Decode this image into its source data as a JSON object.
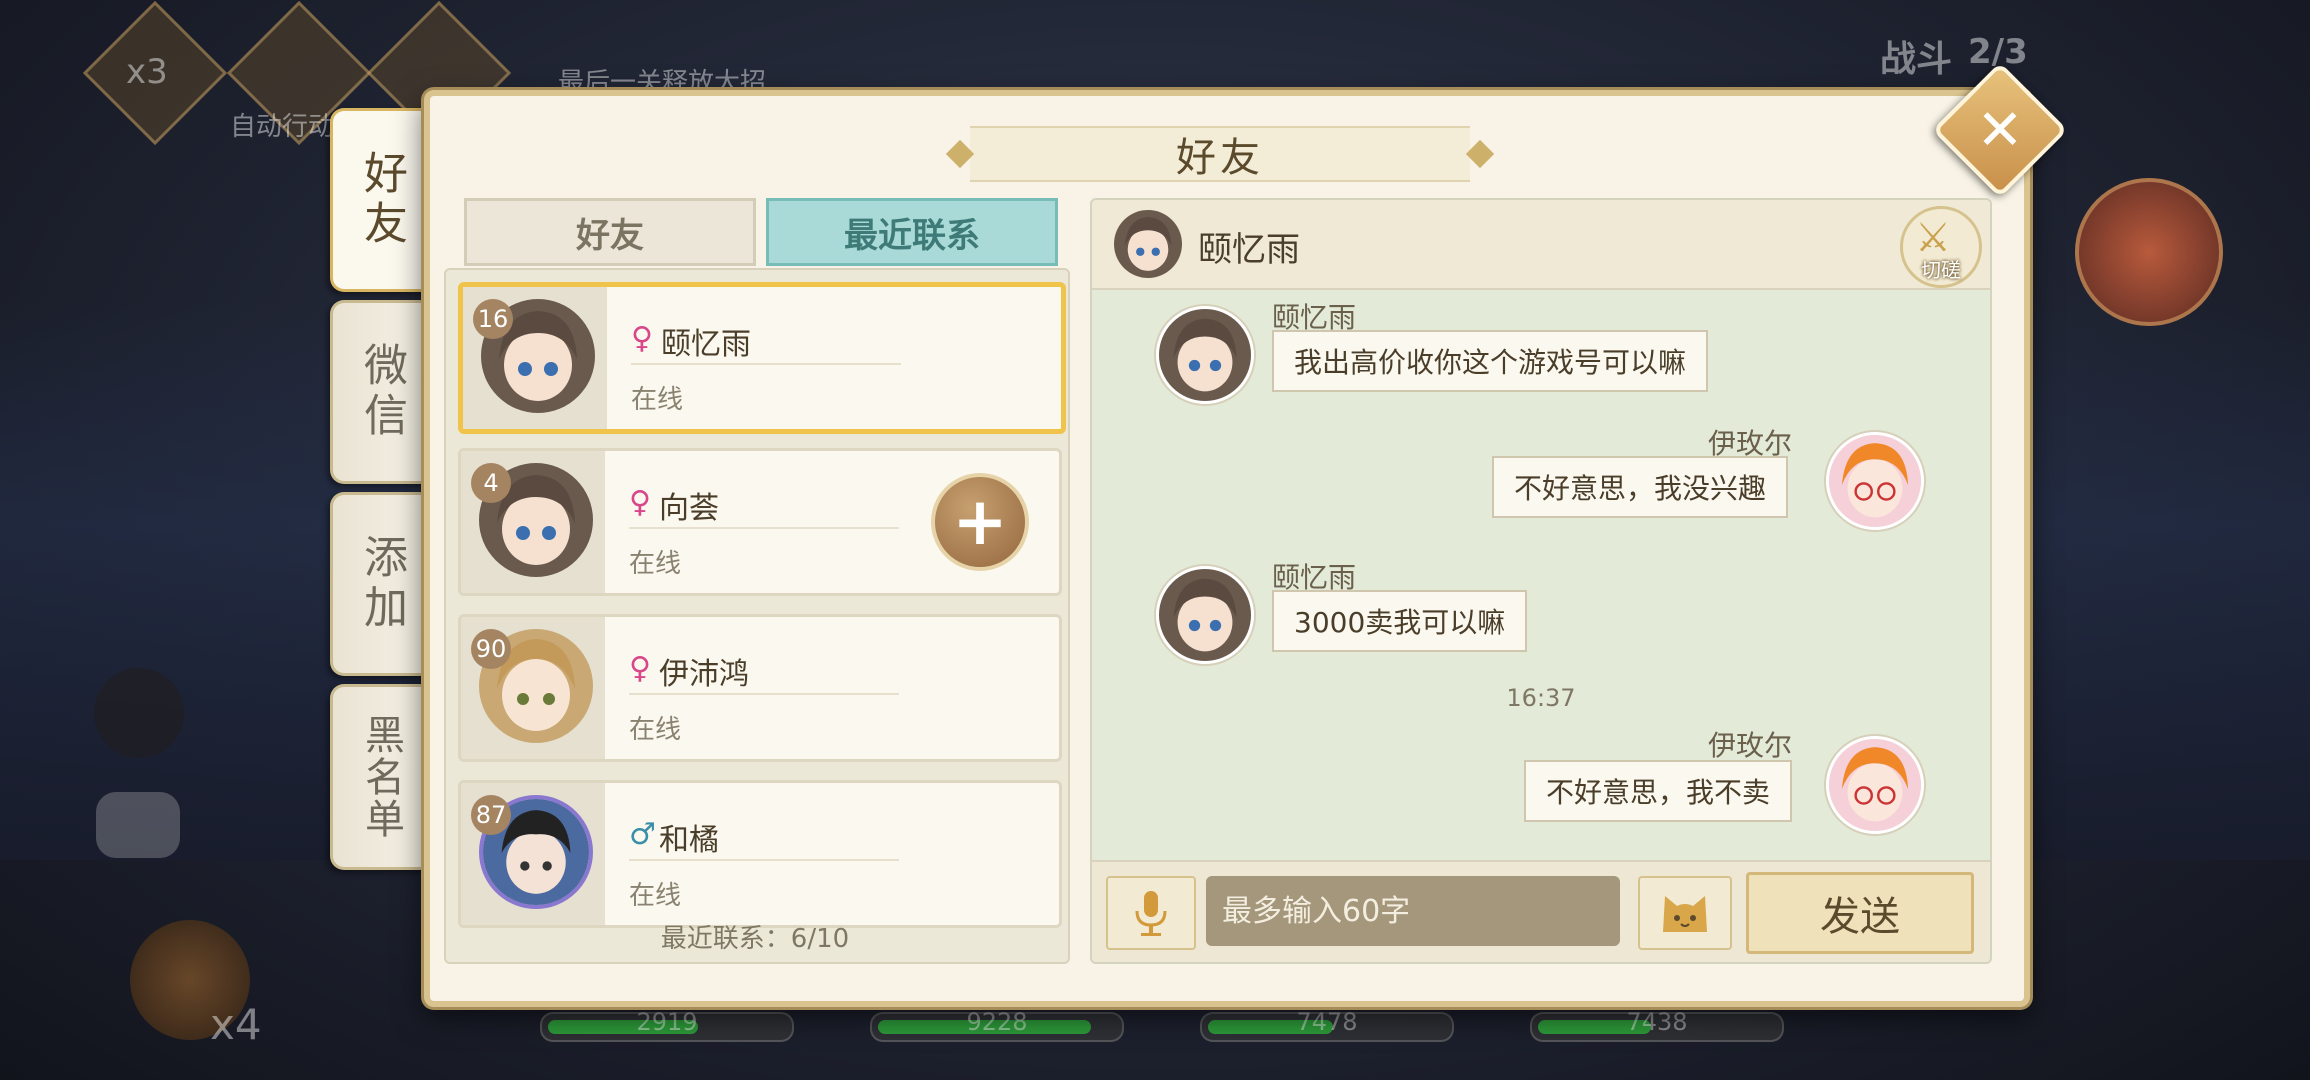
{
  "background": {
    "top_hint": "最后一关释放大招",
    "speed_label": "x3",
    "auto_label": "自动行动",
    "battle_label": "战斗",
    "battle_progress": "2/3",
    "ult_count": "x4",
    "hp_values": [
      "2919",
      "9228",
      "7478",
      "7438"
    ]
  },
  "side_tabs": [
    {
      "label": "好友",
      "active": true
    },
    {
      "label": "微信",
      "active": false
    },
    {
      "label": "添加",
      "active": false
    },
    {
      "label": "黑名单",
      "active": false
    }
  ],
  "panel": {
    "title": "好友",
    "close_label": "✕"
  },
  "list_tabs": {
    "friends": "好友",
    "recent": "最近联系"
  },
  "friends": [
    {
      "level": "16",
      "gender": "♀",
      "name": "颐忆雨",
      "status": "在线",
      "selected": true
    },
    {
      "level": "4",
      "gender": "♀",
      "name": "向荟",
      "status": "在线",
      "selected": false,
      "add_label": "+"
    },
    {
      "level": "90",
      "gender": "♀",
      "name": "伊沛鸿",
      "status": "在线",
      "selected": false
    },
    {
      "level": "87",
      "gender": "♂",
      "name": "和橘",
      "status": "在线",
      "selected": false
    }
  ],
  "recent_count": "最近联系：6/10",
  "chat": {
    "partner_name": "颐忆雨",
    "spar_label": "切磋",
    "messages": [
      {
        "sender": "颐忆雨",
        "text": "我出高价收你这个游戏号可以嘛",
        "side": "left"
      },
      {
        "sender": "伊玫尔",
        "text": "不好意思，我没兴趣",
        "side": "right"
      },
      {
        "sender": "颐忆雨",
        "text": "3000卖我可以嘛",
        "side": "left"
      },
      {
        "sender": "伊玫尔",
        "text": "不好意思，我不卖",
        "side": "right"
      }
    ],
    "timestamp": "16:37",
    "input_placeholder": "最多输入60字",
    "send_label": "发送"
  },
  "colors": {
    "accent_gold": "#f0c34a",
    "tab_active": "#a9dad7",
    "female": "#d9478a",
    "male": "#3a8fa8"
  }
}
